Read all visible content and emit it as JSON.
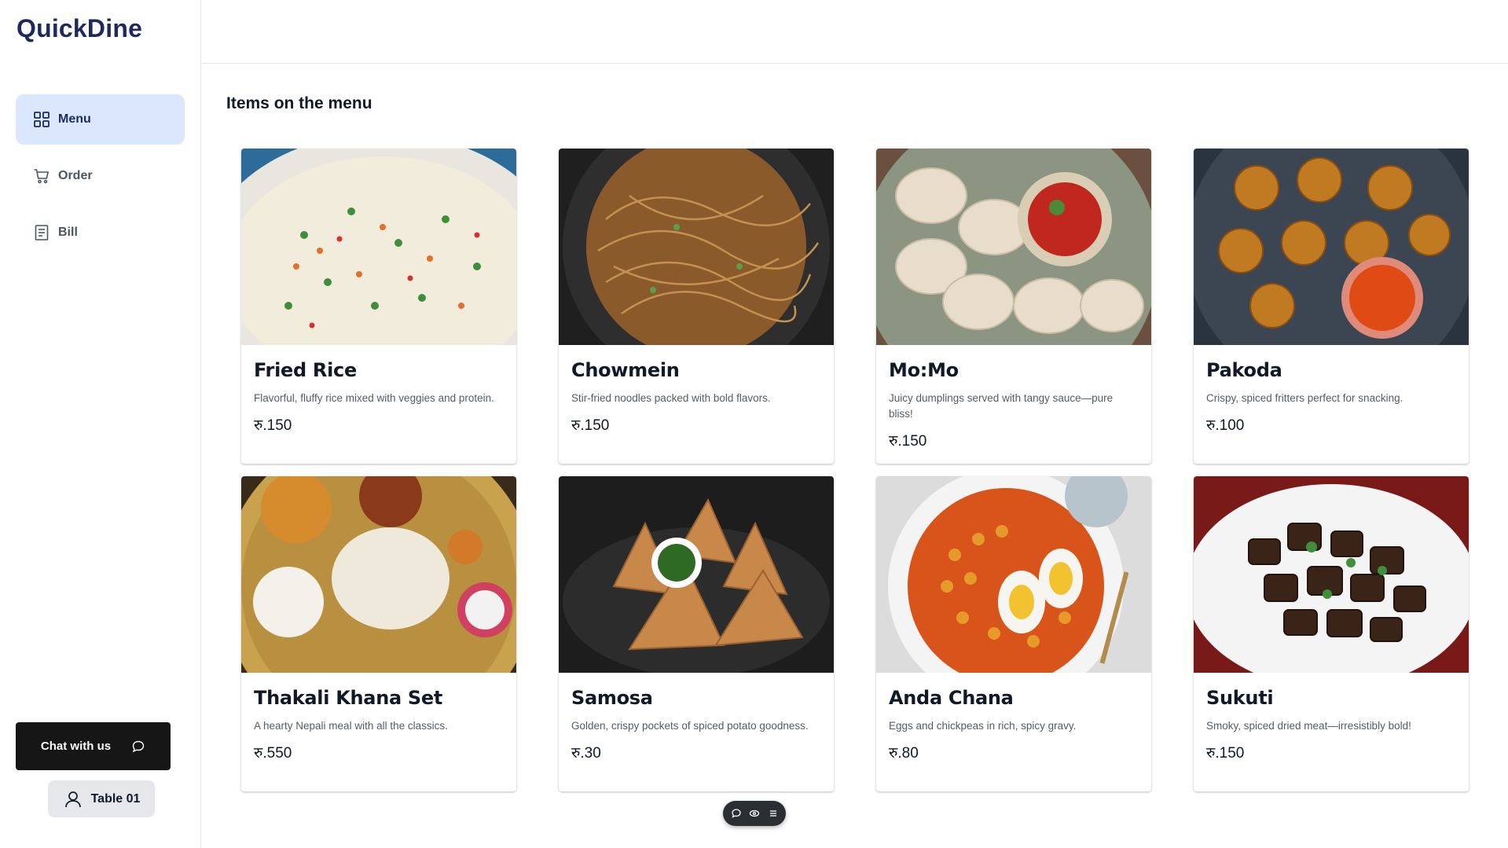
{
  "app": {
    "brand": "QuickDine"
  },
  "sidebar": {
    "items": [
      {
        "label": "Menu",
        "icon": "grid-icon",
        "active": true
      },
      {
        "label": "Order",
        "icon": "cart-icon",
        "active": false
      },
      {
        "label": "Bill",
        "icon": "receipt-icon",
        "active": false
      }
    ],
    "chat_label": "Chat with us",
    "table_label": "Table 01"
  },
  "main": {
    "title": "Items on the menu"
  },
  "menu_items": [
    {
      "name": "Fried Rice",
      "description": "Flavorful, fluffy rice mixed with veggies and protein.",
      "price": "रु.150"
    },
    {
      "name": "Chowmein",
      "description": "Stir-fried noodles packed with bold flavors.",
      "price": "रु.150"
    },
    {
      "name": "Mo:Mo",
      "description": "Juicy dumplings served with tangy sauce—pure bliss!",
      "price": "रु.150"
    },
    {
      "name": "Pakoda",
      "description": "Crispy, spiced fritters perfect for snacking.",
      "price": "रु.100"
    },
    {
      "name": "Thakali Khana Set",
      "description": "A hearty Nepali meal with all the classics.",
      "price": "रु.550"
    },
    {
      "name": "Samosa",
      "description": "Golden, crispy pockets of spiced potato goodness.",
      "price": "रु.30"
    },
    {
      "name": "Anda Chana",
      "description": "Eggs and chickpeas in rich, spicy gravy.",
      "price": "रु.80"
    },
    {
      "name": "Sukuti",
      "description": "Smoky, spiced dried meat—irresistibly bold!",
      "price": "रु.150"
    }
  ],
  "colors": {
    "brand": "#1e2a5e",
    "active_nav_bg": "#dbe7fd",
    "chat_bg": "#161616"
  }
}
